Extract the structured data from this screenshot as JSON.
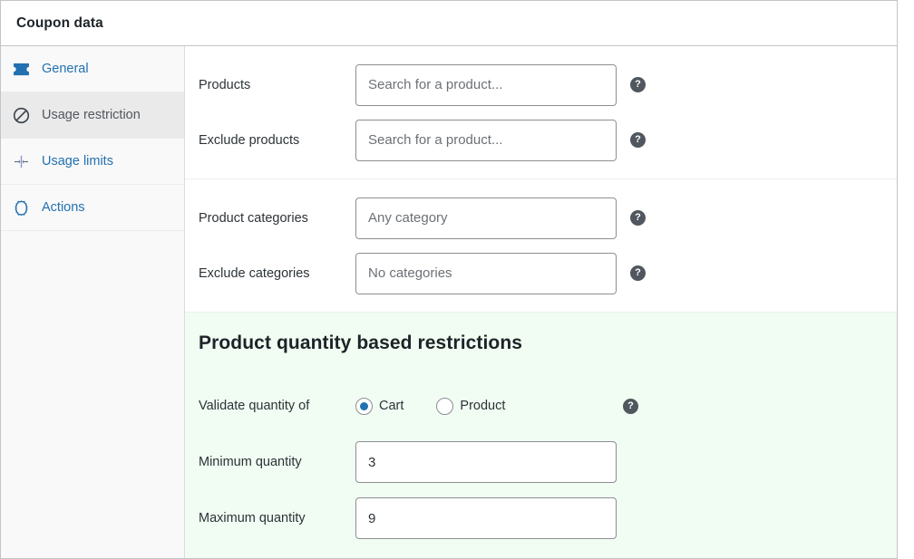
{
  "header": {
    "title": "Coupon data"
  },
  "sidebar": {
    "items": [
      {
        "label": "General",
        "icon": "ticket-icon",
        "active": false
      },
      {
        "label": "Usage restriction",
        "icon": "prohibition-icon",
        "active": true
      },
      {
        "label": "Usage limits",
        "icon": "limits-arrows-icon",
        "active": false
      },
      {
        "label": "Actions",
        "icon": "gear-icon",
        "active": false
      }
    ]
  },
  "main": {
    "groups": [
      {
        "fields": [
          {
            "label": "Products",
            "placeholder": "Search for a product...",
            "value": "",
            "help": "?"
          },
          {
            "label": "Exclude products",
            "placeholder": "Search for a product...",
            "value": "",
            "help": "?"
          }
        ]
      },
      {
        "fields": [
          {
            "label": "Product categories",
            "placeholder": "Any category",
            "value": "",
            "help": "?"
          },
          {
            "label": "Exclude categories",
            "placeholder": "No categories",
            "value": "",
            "help": "?"
          }
        ]
      }
    ],
    "green_section": {
      "heading": "Product quantity based restrictions",
      "validate_label": "Validate quantity of",
      "radio_options": [
        {
          "label": "Cart",
          "checked": true
        },
        {
          "label": "Product",
          "checked": false
        }
      ],
      "validate_help": "?",
      "min_label": "Minimum quantity",
      "min_value": "3",
      "max_label": "Maximum quantity",
      "max_value": "9"
    }
  },
  "colors": {
    "link": "#2271b1",
    "active_tab_bg": "#eaeaea",
    "green_bg": "#f1fcf2",
    "help_bg": "#50575e",
    "radio_accent": "#2271b1"
  }
}
